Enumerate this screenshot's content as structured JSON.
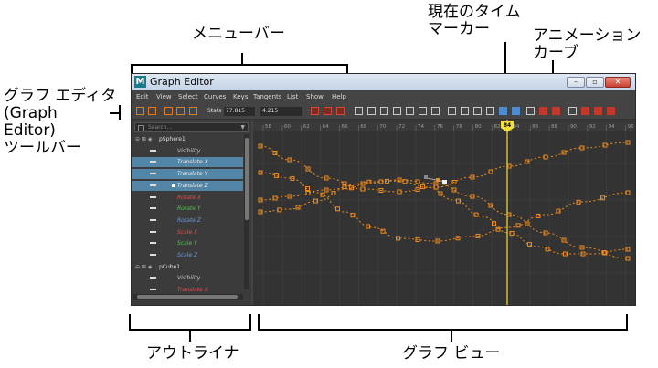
{
  "callouts": {
    "menu_bar": "メニューバー",
    "time_marker": "現在のタイム\nマーカー",
    "anim_curve": "アニメーション\nカーブ",
    "graph_toolbar": "グラフ エディタ\n(Graph\nEditor)\nツールバー",
    "outliner": "アウトライナ",
    "graph_view": "グラフ ビュー"
  },
  "window": {
    "title": "Graph Editor",
    "logo": "M",
    "min_glyph": "–",
    "max_glyph": "▫",
    "close_glyph": "✕"
  },
  "menu": {
    "items": [
      "Edit",
      "View",
      "Select",
      "Curves",
      "Keys",
      "Tangents",
      "List",
      "Show",
      "Help"
    ]
  },
  "toolbar": {
    "stats_label": "Stats",
    "stat_1": "77.815",
    "stat_2": "4.215"
  },
  "outliner": {
    "search_placeholder": "Search...",
    "rows": [
      {
        "kind": "node",
        "label": "pSphere1",
        "expand": "⊖ ⊞ ◈"
      },
      {
        "kind": "ch",
        "label": "Visibility",
        "color": "#c8c8c8",
        "selected": false
      },
      {
        "kind": "ch",
        "label": "Translate X",
        "color": "#f0f0f0",
        "selected": true
      },
      {
        "kind": "ch",
        "label": "Translate Y",
        "color": "#f0f0f0",
        "selected": true
      },
      {
        "kind": "ch",
        "label": "Translate Z",
        "color": "#f0f0f0",
        "selected": true
      },
      {
        "kind": "ch",
        "label": "Rotate X",
        "color": "#e05050",
        "selected": false
      },
      {
        "kind": "ch",
        "label": "Rotate Y",
        "color": "#50c050",
        "selected": false
      },
      {
        "kind": "ch",
        "label": "Rotate Z",
        "color": "#6a9ae0",
        "selected": false
      },
      {
        "kind": "ch",
        "label": "Scale X",
        "color": "#e05050",
        "selected": false
      },
      {
        "kind": "ch",
        "label": "Scale Y",
        "color": "#50c050",
        "selected": false
      },
      {
        "kind": "ch",
        "label": "Scale Z",
        "color": "#6a9ae0",
        "selected": false
      },
      {
        "kind": "node",
        "label": "pCube1",
        "expand": "⊖ ⊞ ◈"
      },
      {
        "kind": "ch",
        "label": "Visibility",
        "color": "#c8c8c8",
        "selected": false
      },
      {
        "kind": "ch",
        "label": "Translate X",
        "color": "#e05050",
        "selected": false
      }
    ]
  },
  "graph": {
    "current_frame": "84",
    "frame_ticks": [
      "58",
      "60",
      "62",
      "64",
      "66",
      "68",
      "70",
      "72",
      "74",
      "76",
      "78",
      "80",
      "82",
      "84",
      "86",
      "88",
      "90",
      "92",
      "94",
      "96"
    ],
    "curve_color": "#f08c1e",
    "marker_color": "#f5e03a",
    "background": "#333333"
  }
}
